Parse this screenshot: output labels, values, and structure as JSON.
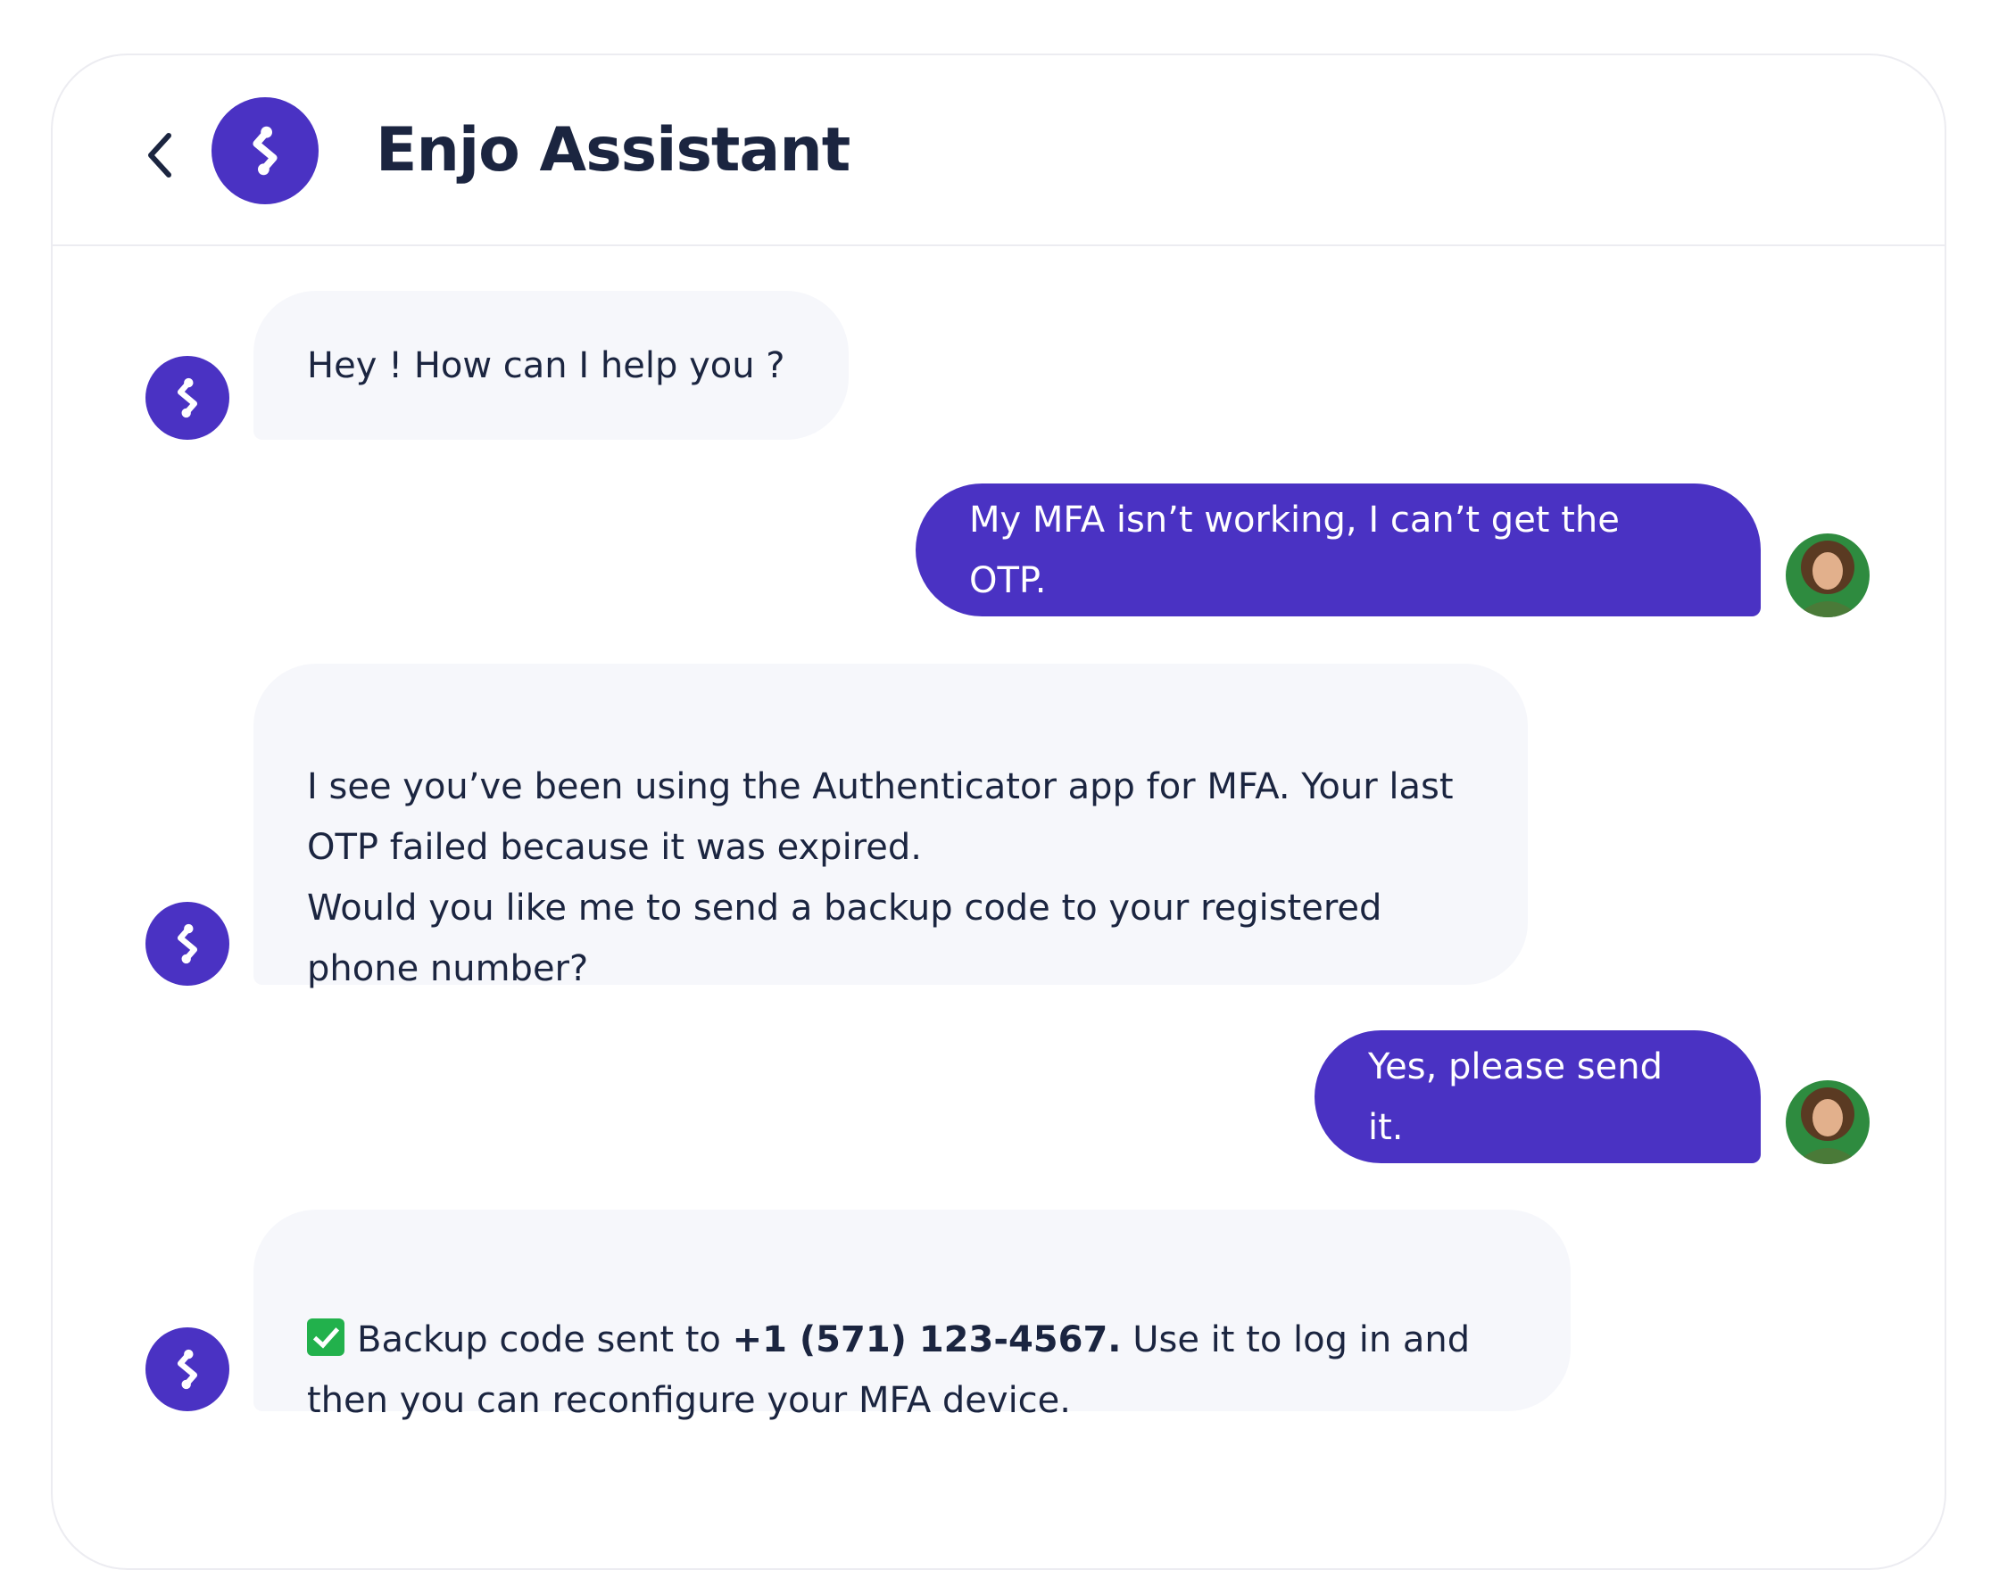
{
  "header": {
    "title": "Enjo Assistant",
    "back_icon": "chevron-left-icon",
    "logo_icon": "enjo-logo-icon"
  },
  "colors": {
    "brand": "#4a32c3",
    "bot_bubble": "#f6f7fb",
    "text": "#1b2540"
  },
  "messages": [
    {
      "sender": "bot",
      "text": "Hey ! How can I help you ?"
    },
    {
      "sender": "user",
      "text": "My MFA isn’t working, I can’t get the OTP."
    },
    {
      "sender": "bot",
      "text": "I see you’ve been using the Authenticator app for MFA. Your last OTP failed because it was expired.\nWould you like me to send a backup code to your registered phone number?"
    },
    {
      "sender": "user",
      "text": "Yes, please send it."
    },
    {
      "sender": "bot",
      "text_before": "Backup code sent to ",
      "phone": "+1 (571) 123-4567.",
      "text_after": " Use it to log in and then you can reconfigure your MFA device.",
      "icon": "check-mark-icon"
    }
  ]
}
